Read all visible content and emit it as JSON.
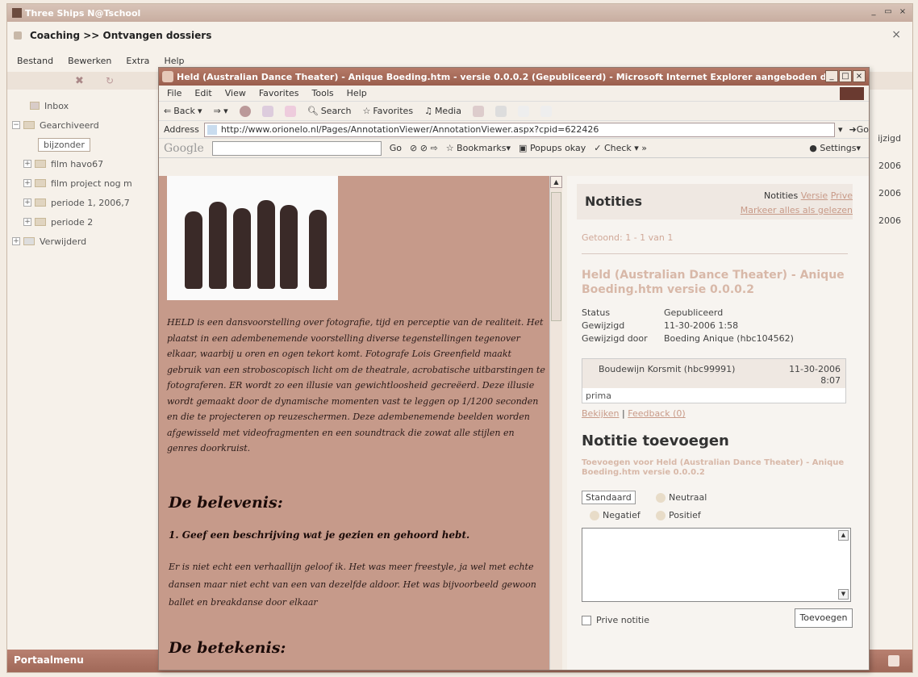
{
  "app": {
    "title": "Three Ships N@Tschool",
    "breadcrumb": "Coaching >> Ontvangen dossiers",
    "menu": [
      "Bestand",
      "Bewerken",
      "Extra",
      "Help"
    ],
    "tree": [
      {
        "label": "Inbox"
      },
      {
        "label": "Gearchiveerd"
      },
      {
        "label": "bijzonder"
      },
      {
        "label": "film havo67"
      },
      {
        "label": "film project nog m"
      },
      {
        "label": "periode 1, 2006,7"
      },
      {
        "label": "periode 2"
      },
      {
        "label": "Verwijderd"
      }
    ],
    "behind_col": {
      "header": "ijzigd",
      "dates": [
        "2006",
        "2006",
        "2006"
      ]
    },
    "bottom": {
      "portal_menu": "Portaalmenu"
    }
  },
  "browser": {
    "title": "Held (Australian Dance Theater) - Anique Boeding.htm - versie 0.0.0.2 (Gepubliceerd) - Microsoft Internet Explorer aangeboden d",
    "menu": [
      "File",
      "Edit",
      "View",
      "Favorites",
      "Tools",
      "Help"
    ],
    "toolbar": {
      "back": "Back",
      "search": "Search",
      "favorites": "Favorites",
      "media": "Media"
    },
    "address": {
      "label": "Address",
      "url": "http://www.orionelo.nl/Pages/AnnotationViewer/AnnotationViewer.aspx?cpid=622426",
      "go": "Go"
    },
    "google": {
      "logo": "Google",
      "go": "Go",
      "bookmarks": "Bookmarks",
      "popups": "Popups okay",
      "check": "Check",
      "settings": "Settings"
    }
  },
  "document": {
    "intro": "HELD is een dansvoorstelling over fotografie, tijd en perceptie van de realiteit. Het plaatst in een adembenemende voorstelling diverse tegenstellingen tegenover elkaar, waarbij u oren en ogen tekort komt. Fotografe Lois Greenfield maakt gebruik van een stroboscopisch licht om de theatrale, acrobatische uitbarstingen te fotograferen. ER wordt zo een illusie van gewichtloosheid gecreëerd. Deze illusie wordt gemaakt door de dynamische momenten vast te leggen op 1/1200 seconden en die te projecteren op reuzeschermen. Deze adembenemende beelden worden afgewisseld met videofragmenten en een soundtrack die zowat alle stijlen en genres doorkruist.",
    "heading1": "De belevenis:",
    "question1": "1. Geef een beschrijving wat je gezien en gehoord hebt.",
    "answer1": "Er is niet echt een verhaallijn geloof ik. Het was meer freestyle, ja wel met echte dansen maar niet echt van een van dezelfde aldoor. Het was bijvoorbeeld gewoon ballet en breakdanse door elkaar",
    "heading2": "De betekenis:"
  },
  "notes": {
    "title": "Notities",
    "tab_notities": "Notities",
    "tab_versie": "Versie",
    "tab_prive": "Prive",
    "mark_all": "Markeer alles als gelezen",
    "shown": "Getoond: 1 - 1 van 1",
    "doc_title": "Held (Australian Dance Theater) - Anique Boeding.htm versie 0.0.0.2",
    "meta": [
      {
        "label": "Status",
        "value": "Gepubliceerd"
      },
      {
        "label": "Gewijzigd",
        "value": "11-30-2006 1:58"
      },
      {
        "label": "Gewijzigd door",
        "value": "Boeding Anique (hbc104562)"
      }
    ],
    "comment": {
      "author": "Boudewijn Korsmit (hbc99991)",
      "date": "11-30-2006",
      "time": "8:07",
      "text": "prima"
    },
    "view_link": "Bekijken",
    "feedback_link": "Feedback (0)",
    "add_title": "Notitie toevoegen",
    "add_for": "Toevoegen voor Held (Australian Dance Theater) - Anique Boeding.htm versie 0.0.0.2",
    "sentiments": {
      "standard": "Standaard",
      "neutral": "Neutraal",
      "negative": "Negatief",
      "positive": "Positief"
    },
    "private_label": "Prive notitie",
    "add_button": "Toevoegen"
  },
  "colors": {
    "accent": "#9a5e4d",
    "page_bg": "#c69a8a"
  }
}
